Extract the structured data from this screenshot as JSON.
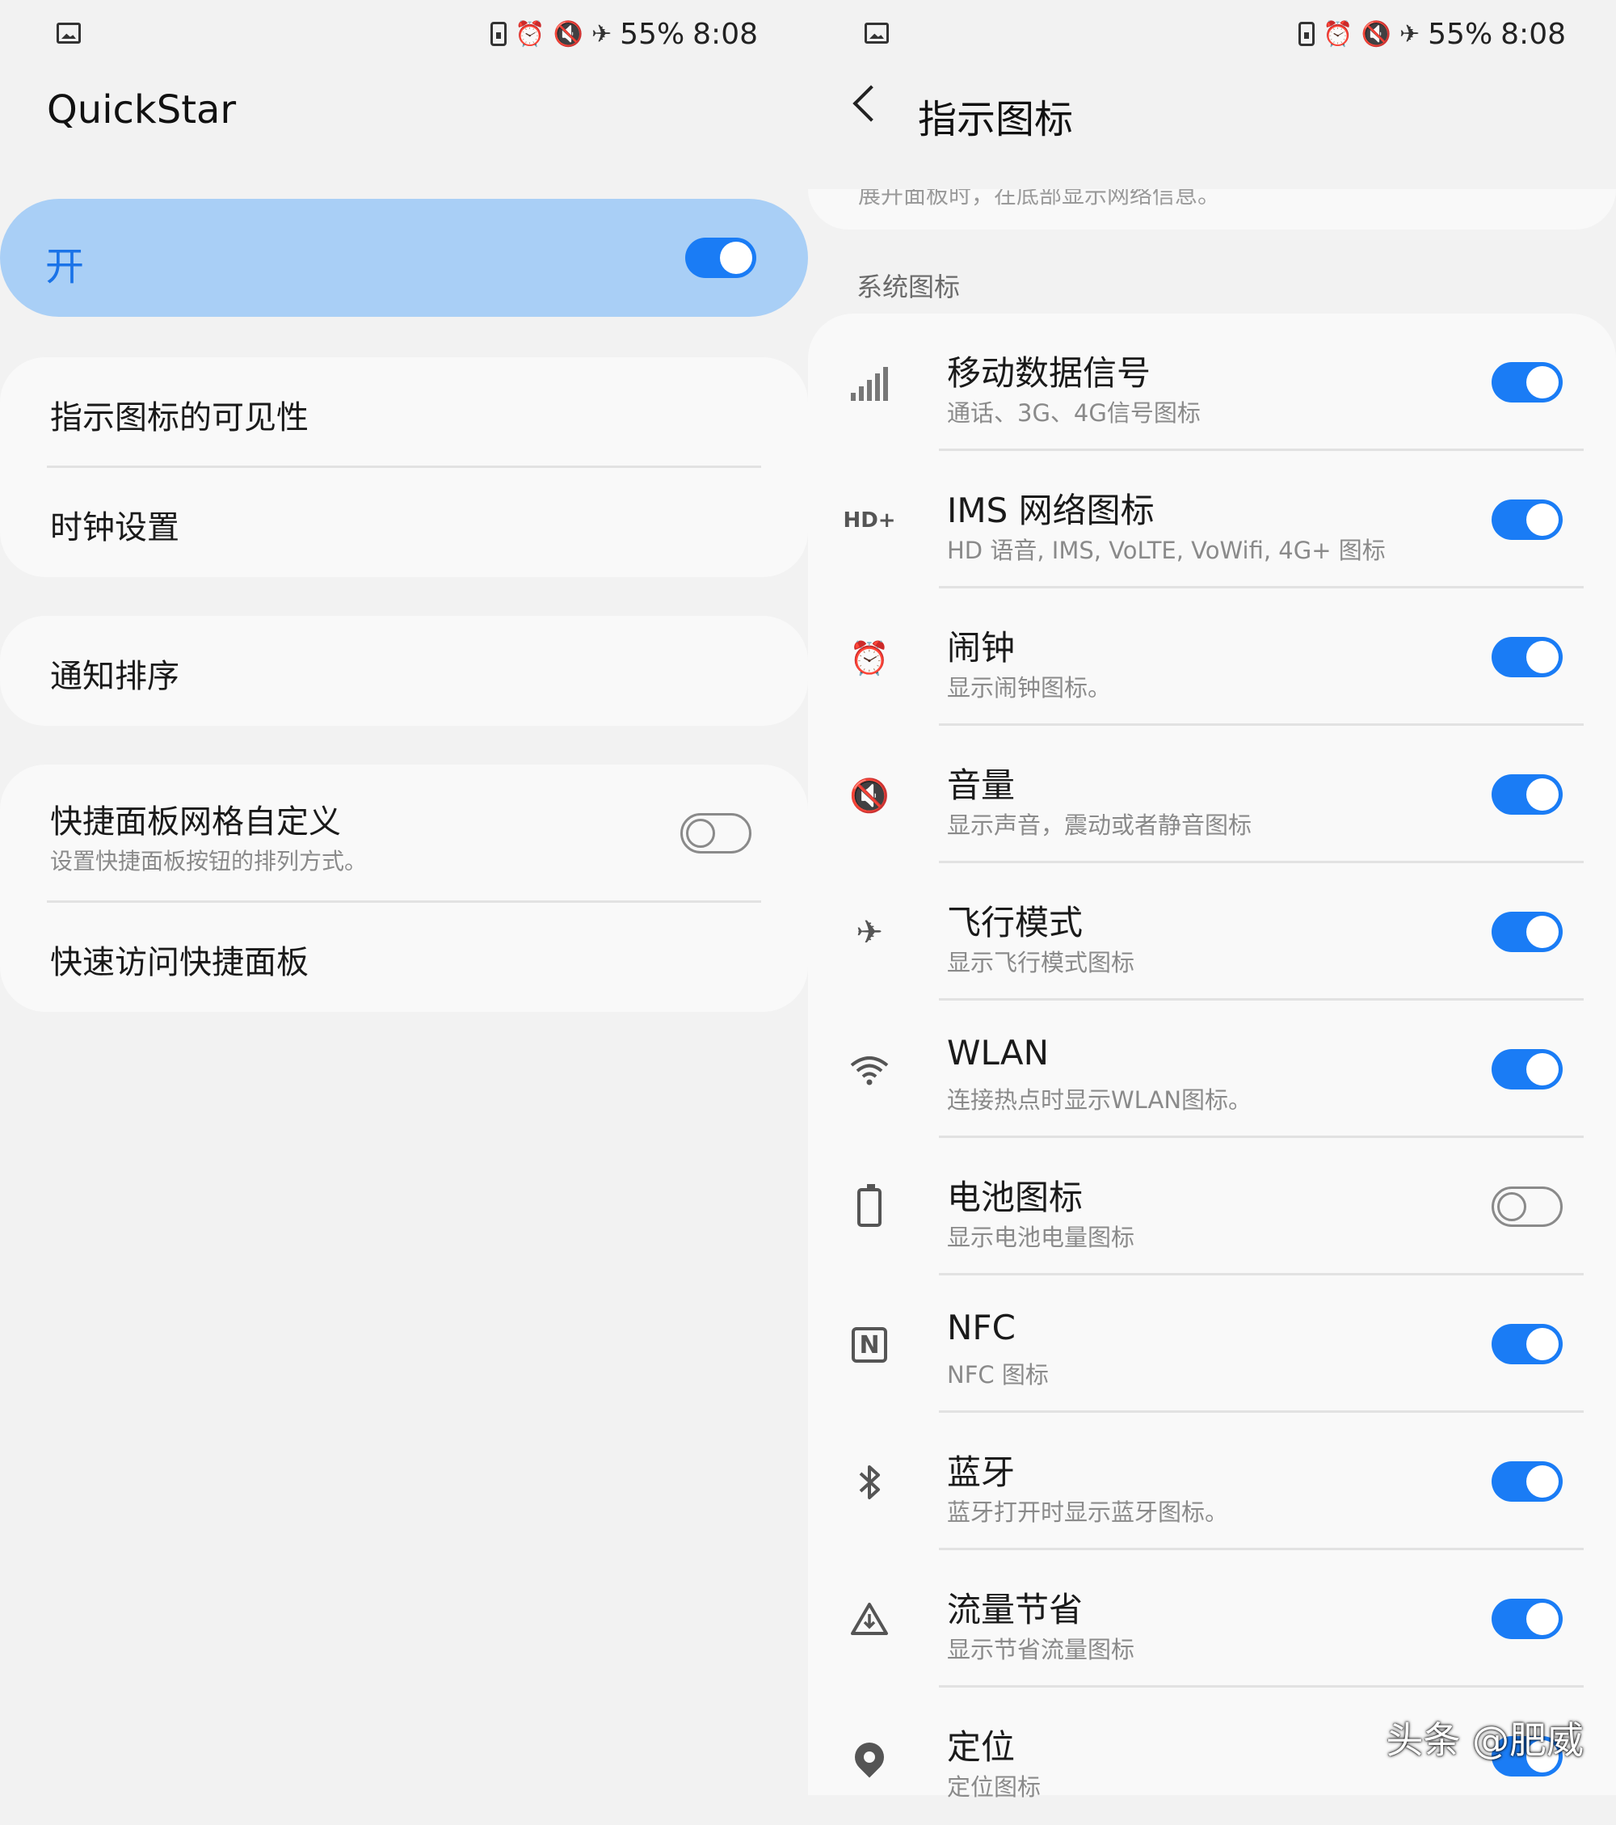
{
  "left": {
    "status": {
      "battery": "55%",
      "time": "8:08"
    },
    "app_title": "QuickStar",
    "master_switch": {
      "label": "开",
      "on": true
    },
    "group1": [
      {
        "label": "指示图标的可见性"
      },
      {
        "label": "时钟设置"
      }
    ],
    "group2": [
      {
        "label": "通知排序"
      }
    ],
    "group3": {
      "grid": {
        "label": "快捷面板网格自定义",
        "sub": "设置快捷面板按钮的排列方式。",
        "on": false
      },
      "quick_access": {
        "label": "快速访问快捷面板"
      }
    }
  },
  "right": {
    "status": {
      "battery": "55%",
      "time": "8:08"
    },
    "title": "指示图标",
    "cut_text": "展开面板时，在底部显示网络信息。",
    "section": "系统图标",
    "items": [
      {
        "icon": "signal-icon",
        "title": "移动数据信号",
        "sub": "通话、3G、4G信号图标",
        "on": true
      },
      {
        "icon": "hd-plus-icon",
        "icon_text": "HD+",
        "title": "IMS 网络图标",
        "sub": "HD 语音, IMS, VoLTE, VoWifi, 4G+ 图标",
        "on": true
      },
      {
        "icon": "alarm-icon",
        "title": "闹钟",
        "sub": "显示闹钟图标。",
        "on": true
      },
      {
        "icon": "volume-mute-icon",
        "title": "音量",
        "sub": "显示声音，震动或者静音图标",
        "on": true
      },
      {
        "icon": "airplane-icon",
        "title": "飞行模式",
        "sub": "显示飞行模式图标",
        "on": true
      },
      {
        "icon": "wifi-icon",
        "title": "WLAN",
        "sub": "连接热点时显示WLAN图标。",
        "on": true
      },
      {
        "icon": "battery-icon",
        "title": "电池图标",
        "sub": "显示电池电量图标",
        "on": false
      },
      {
        "icon": "nfc-icon",
        "title": "NFC",
        "sub": "NFC 图标",
        "on": true
      },
      {
        "icon": "bluetooth-icon",
        "title": "蓝牙",
        "sub": "蓝牙打开时显示蓝牙图标。",
        "on": true
      },
      {
        "icon": "data-saver-icon",
        "title": "流量节省",
        "sub": "显示节省流量图标",
        "on": true
      },
      {
        "icon": "location-icon",
        "title": "定位",
        "sub": "定位图标",
        "on": true
      }
    ]
  },
  "watermark": "头条 @肥威",
  "colors": {
    "accent": "#1a7cf5",
    "highlight": "#a9cff6",
    "background": "#f2f2f2",
    "card": "#f9f9f9"
  }
}
